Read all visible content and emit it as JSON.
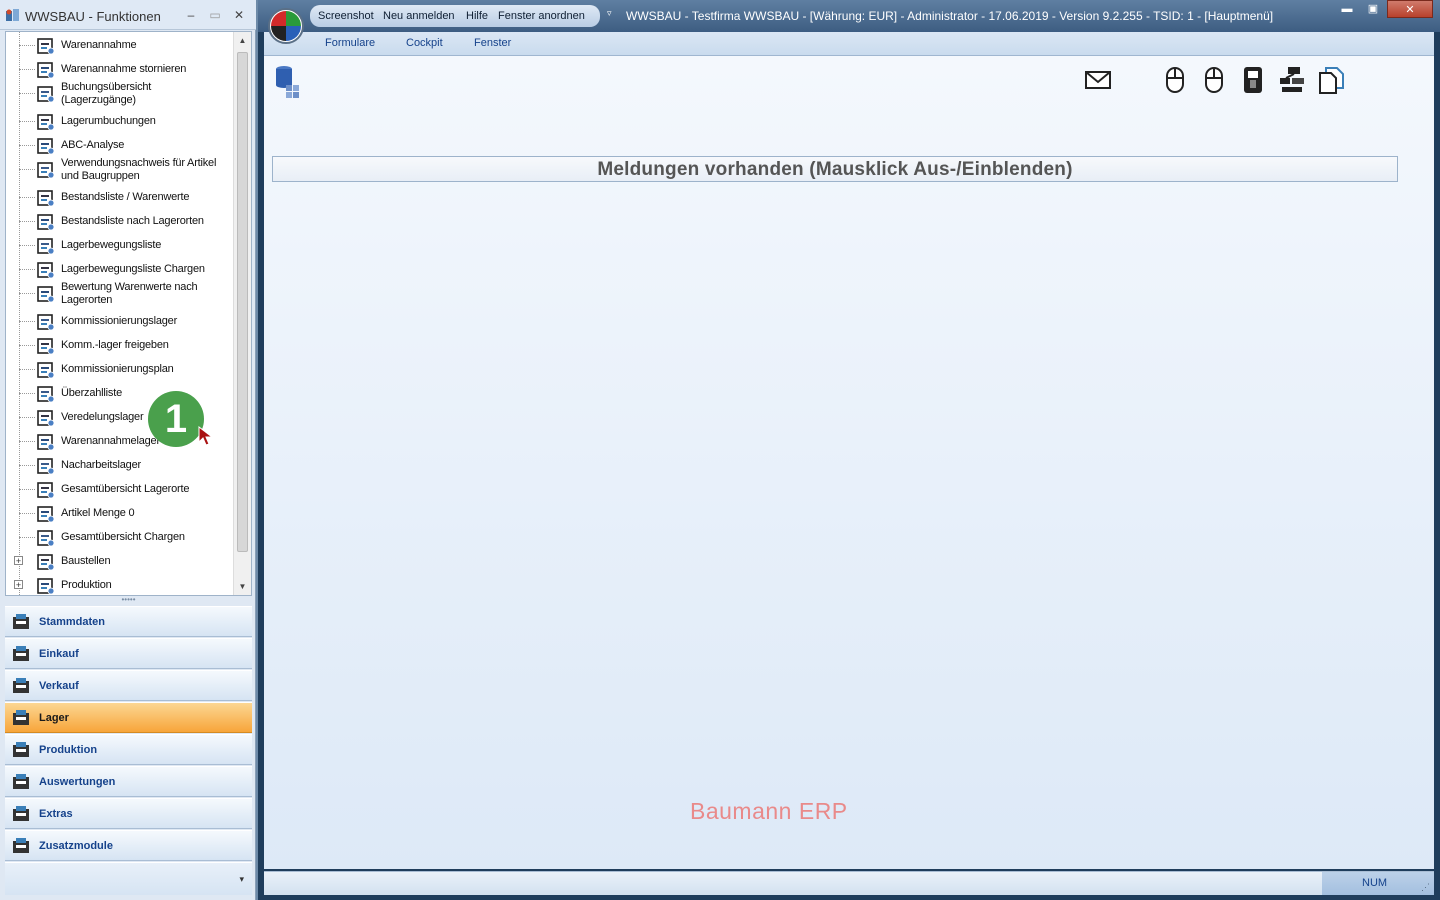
{
  "left_window": {
    "title": "WWSBAU - Funktionen",
    "min_glyph": "–",
    "max_glyph": "▭",
    "close_glyph": "✕",
    "tree_items": [
      {
        "label": "Warenannahme",
        "icon": "warenannahme-icon"
      },
      {
        "label": "Warenannahme stornieren",
        "icon": "storno-icon"
      },
      {
        "label": "Buchungsübersicht (Lagerzugänge)",
        "icon": "buchung-icon"
      },
      {
        "label": "Lagerumbuchungen",
        "icon": "umbuchung-icon"
      },
      {
        "label": "ABC-Analyse",
        "icon": "abc-icon"
      },
      {
        "label": "Verwendungsnachweis für Artikel und Baugruppen",
        "icon": "verwendung-icon"
      },
      {
        "label": "Bestandsliste / Warenwerte",
        "icon": "bestand-icon"
      },
      {
        "label": "Bestandsliste nach Lagerorten",
        "icon": "lagerorte-icon"
      },
      {
        "label": "Lagerbewegungsliste",
        "icon": "bewegung-icon"
      },
      {
        "label": "Lagerbewegungsliste Chargen",
        "icon": "chargen-icon"
      },
      {
        "label": "Bewertung Warenwerte nach Lagerorten",
        "icon": "bewertung-icon"
      },
      {
        "label": "Kommissionierungslager",
        "icon": "kommission-icon"
      },
      {
        "label": "Komm.-lager freigeben",
        "icon": "freigeben-icon"
      },
      {
        "label": "Kommissionierungsplan",
        "icon": "plan-icon"
      },
      {
        "label": "Überzahlliste",
        "icon": "ueberzahl-icon"
      },
      {
        "label": "Veredelungslager",
        "icon": "veredelung-icon"
      },
      {
        "label": "Warenannahmelager",
        "icon": "annahmelager-icon"
      },
      {
        "label": "Nacharbeitslager",
        "icon": "nacharbeit-icon"
      },
      {
        "label": "Gesamtübersicht Lagerorte",
        "icon": "map-pin-icon"
      },
      {
        "label": "Artikel Menge 0",
        "icon": "warning-box-icon"
      },
      {
        "label": "Gesamtübersicht Chargen",
        "icon": "monitor-icon"
      },
      {
        "label": "Baustellen",
        "icon": "baustellen-icon"
      },
      {
        "label": "Produktion",
        "icon": "produktion-icon"
      }
    ],
    "expand_glyph": "+",
    "badge": "1",
    "scroll_up": "▲",
    "scroll_down": "▼",
    "splitter_glyph": "•••••",
    "nav_buttons": [
      {
        "label": "Stammdaten",
        "active": false
      },
      {
        "label": "Einkauf",
        "active": false
      },
      {
        "label": "Verkauf",
        "active": false
      },
      {
        "label": "Lager",
        "active": true
      },
      {
        "label": "Produktion",
        "active": false
      },
      {
        "label": "Auswertungen",
        "active": false
      },
      {
        "label": "Extras",
        "active": false
      },
      {
        "label": "Zusatzmodule",
        "active": false
      }
    ],
    "nav_footer_chevron": "▾"
  },
  "main_window": {
    "quick_access": [
      "Screenshot",
      "Neu anmelden",
      "Hilfe",
      "Fenster anordnen"
    ],
    "qat_dropdown": "▿",
    "caption": "WWSBAU - Testfirma WWSBAU - [Währung: EUR] - Administrator - 17.06.2019 - Version 9.2.255 - TSID: 1  - [Hauptmenü]",
    "min_glyph": "▬",
    "max_glyph": "▣",
    "close_glyph": "✕",
    "ribbon_tabs": [
      "Formulare",
      "Cockpit",
      "Fenster"
    ],
    "toolbar_icons": [
      "mail-icon",
      "mouse-left-icon",
      "mouse-right-icon",
      "usb-key-icon",
      "network-tree-icon",
      "copy-document-icon"
    ],
    "message_bar": "Meldungen vorhanden  (Mausklick Aus-/Einblenden)",
    "brand_text": "Baumann ERP",
    "status": {
      "num": "NUM",
      "grip": "⋰"
    }
  },
  "colors": {
    "active_nav": "#f7a53a",
    "nav_text": "#15428b",
    "brand": "#e98a8a",
    "badge": "#4aa04c"
  }
}
